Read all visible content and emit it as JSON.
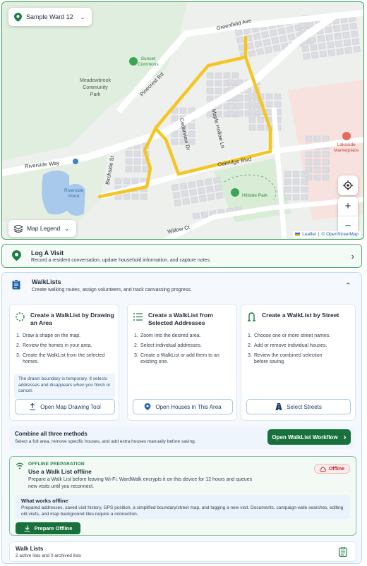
{
  "map": {
    "ward_selector": "Sample Ward 12",
    "legend_button": "Map Legend",
    "labels": {
      "greenfield": "Greenfield Ave",
      "pinecrest": "Pinecrest Rd",
      "riverside_way": "Riverside Way",
      "birchside": "Birchside St",
      "cedarview": "Cedarview Dr",
      "maple": "Maple Hollow Ln",
      "oakridge": "Oakridge Blvd",
      "willow": "Willow Ct",
      "sunset": "Sunset\nCommons",
      "meadowbrook": "Meadowbrook\nCommunity\nPark",
      "riverside_pond": "Riverside\nPond",
      "hillside": "Hillside Park",
      "lakeside": "Lakeside\nMarketplace"
    },
    "attribution": {
      "leaflet": "Leaflet",
      "separator": "|",
      "osm": "© OpenStreetMap"
    },
    "zoom_in": "+",
    "zoom_out": "−",
    "route_color": "#f3c623"
  },
  "log_visit": {
    "title": "Log A Visit",
    "subtitle": "Record a resident conversation, update household information, and capture notes."
  },
  "walklists": {
    "title": "WalkLists",
    "subtitle": "Create walking routes, assign volunteers, and track canvassing progress.",
    "methods": [
      {
        "title": "Create a WalkList by Drawing an Area",
        "steps": [
          "Draw a shape on the map.",
          "Review the homes in your area.",
          "Create the WalkList from the selected homes."
        ],
        "note": "The drawn boundary is temporary. It selects addresses and disappears when you finish or cancel.",
        "button": "Open Map Drawing Tool"
      },
      {
        "title": "Create a WalkList from Selected Addresses",
        "steps": [
          "Zoom into the desired area.",
          "Select individual addresses.",
          "Create a WalkList or add them to an existing one."
        ],
        "button": "Open Houses in This Area"
      },
      {
        "title": "Create a WalkList by Street",
        "steps": [
          "Choose one or more street names.",
          "Add or remove individual houses.",
          "Review the combined selection before saving."
        ],
        "button": "Select Streets"
      }
    ],
    "combine": {
      "title": "Combine all three methods",
      "subtitle": "Select a full area, remove specific houses, and add extra houses manually before saving.",
      "button": "Open WalkList Workflow"
    },
    "offline": {
      "tag": "OFFLINE PREPARATION",
      "title": "Use a Walk List offline",
      "text": "Prepare a Walk List before leaving Wi-Fi. WardWalk encrypts it on this device for 12 hours and queues new visits until you reconnect.",
      "status": "Offline",
      "works_title": "What works offline",
      "works_text": "Prepared addresses, saved visit history, GPS position, a simplified boundary/street map, and logging a new visit. Documents, campaign-wide searches, editing old visits, and map background tiles require a connection.",
      "button": "Prepare Offline"
    },
    "lists": {
      "title": "Walk Lists",
      "subtitle": "2 active lists and 0 archived lists"
    }
  }
}
